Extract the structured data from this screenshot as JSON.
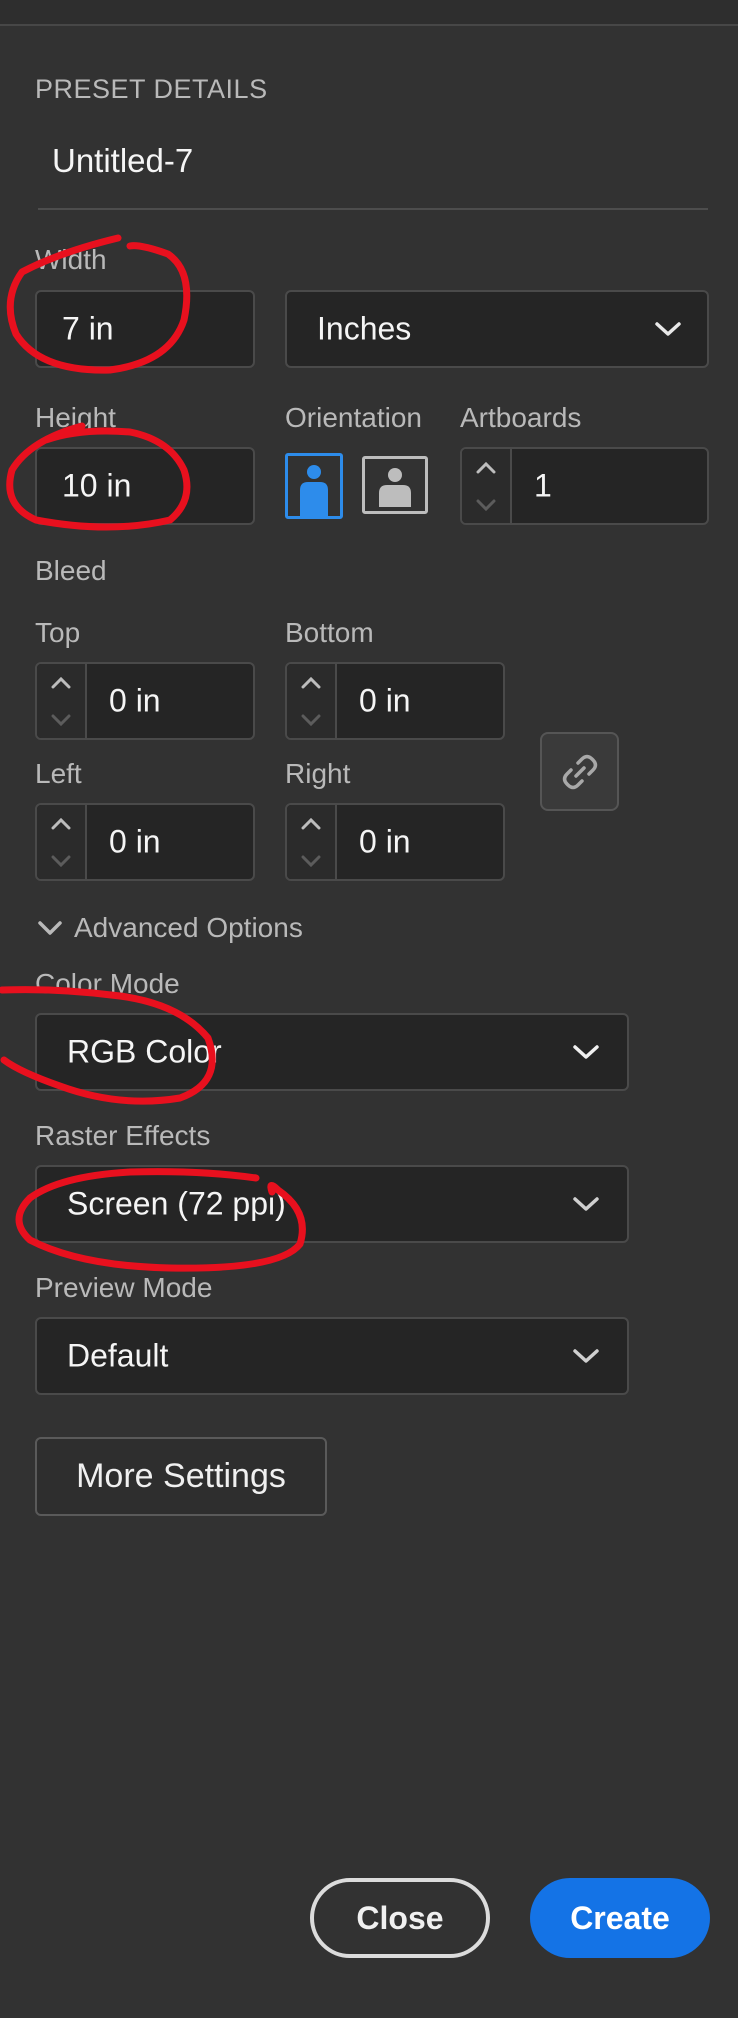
{
  "preset": {
    "section_title": "PRESET DETAILS",
    "name": "Untitled-7"
  },
  "width": {
    "label": "Width",
    "value": "7 in"
  },
  "units": {
    "selected": "Inches"
  },
  "height": {
    "label": "Height",
    "value": "10 in"
  },
  "orientation": {
    "label": "Orientation",
    "selected": "portrait",
    "accent": "#2d8ceb"
  },
  "artboards": {
    "label": "Artboards",
    "value": "1"
  },
  "bleed": {
    "label": "Bleed",
    "top_label": "Top",
    "top_value": "0 in",
    "bottom_label": "Bottom",
    "bottom_value": "0 in",
    "left_label": "Left",
    "left_value": "0 in",
    "right_label": "Right",
    "right_value": "0 in"
  },
  "advanced": {
    "toggle_label": "Advanced Options",
    "color_mode_label": "Color Mode",
    "color_mode_value": "RGB Color",
    "raster_label": "Raster Effects",
    "raster_value": "Screen (72 ppi)",
    "preview_label": "Preview Mode",
    "preview_value": "Default"
  },
  "more_settings_label": "More Settings",
  "footer": {
    "close_label": "Close",
    "create_label": "Create",
    "create_color": "#1473e6"
  },
  "annotation_color": "#e8101e"
}
